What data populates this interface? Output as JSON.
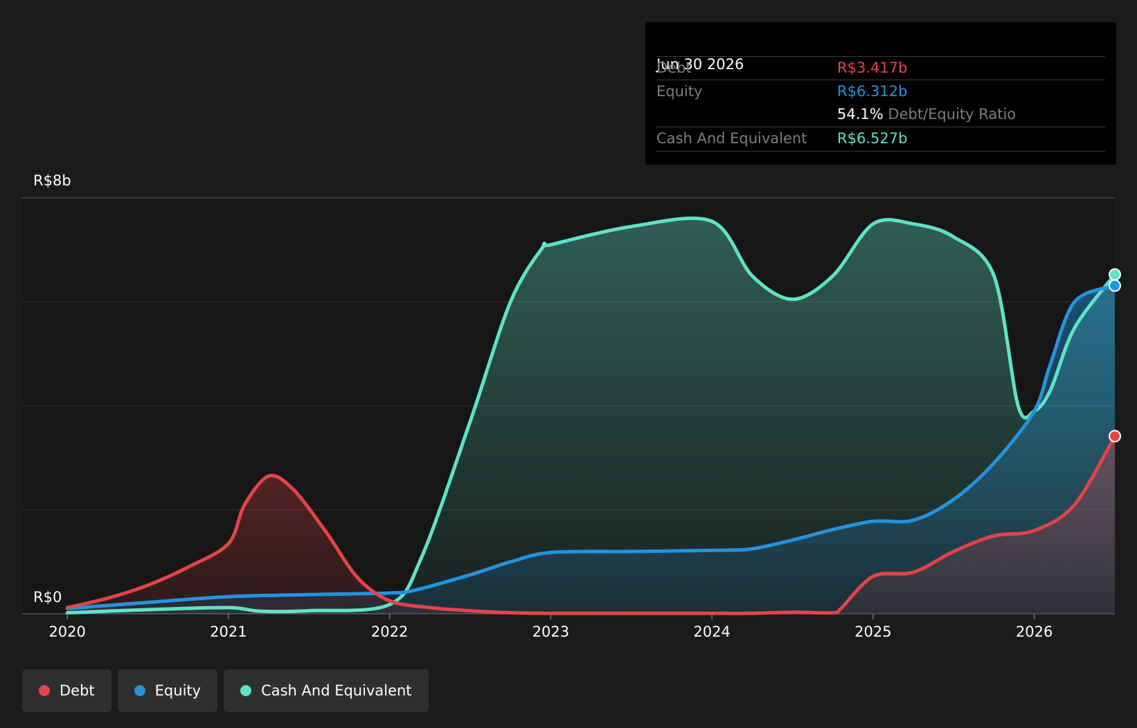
{
  "tooltip": {
    "date": "Jun 30 2026",
    "debt_label": "Debt",
    "debt_value": "R$3.417b",
    "equity_label": "Equity",
    "equity_value": "R$6.312b",
    "ratio_value": "54.1%",
    "ratio_label": "Debt/Equity Ratio",
    "cash_label": "Cash And Equivalent",
    "cash_value": "R$6.527b"
  },
  "colors": {
    "debt": "#e5434a",
    "equity": "#2394df",
    "cash": "#5ee2c6",
    "background": "#1b1b1b"
  },
  "legend": [
    {
      "label": "Debt",
      "color": "#e5434a"
    },
    {
      "label": "Equity",
      "color": "#2394df"
    },
    {
      "label": "Cash And Equivalent",
      "color": "#5ee2c6"
    }
  ],
  "chart_data": {
    "type": "area",
    "y_tick_labels": [
      "R$0",
      "R$8b"
    ],
    "ylim": [
      0,
      8
    ],
    "x_ticks": [
      "2020",
      "2021",
      "2022",
      "2023",
      "2024",
      "2025",
      "2026"
    ],
    "xlim": [
      2019.72,
      2026.5
    ],
    "grid": true,
    "legend_position": "bottom-left",
    "series": [
      {
        "name": "Debt",
        "x": [
          2020.0,
          2020.25,
          2020.5,
          2020.75,
          2021.0,
          2021.1,
          2021.25,
          2021.4,
          2021.6,
          2021.8,
          2022.0,
          2022.25,
          2022.5,
          2022.75,
          2023.0,
          2023.5,
          2024.0,
          2024.25,
          2024.5,
          2024.75,
          2024.8,
          2025.0,
          2025.25,
          2025.5,
          2025.75,
          2026.0,
          2026.25,
          2026.5
        ],
        "y": [
          0.12,
          0.3,
          0.55,
          0.9,
          1.35,
          2.1,
          2.65,
          2.4,
          1.6,
          0.7,
          0.25,
          0.12,
          0.06,
          0.02,
          0.01,
          0.01,
          0.01,
          0.01,
          0.03,
          0.02,
          0.1,
          0.72,
          0.8,
          1.2,
          1.5,
          1.6,
          2.1,
          3.417
        ]
      },
      {
        "name": "Equity",
        "x": [
          2020.0,
          2020.5,
          2021.0,
          2021.5,
          2022.0,
          2022.15,
          2022.5,
          2022.75,
          2023.0,
          2023.5,
          2024.0,
          2024.25,
          2024.5,
          2024.75,
          2025.0,
          2025.25,
          2025.5,
          2025.75,
          2026.0,
          2026.1,
          2026.25,
          2026.5
        ],
        "y": [
          0.1,
          0.22,
          0.33,
          0.37,
          0.4,
          0.45,
          0.75,
          1.0,
          1.18,
          1.2,
          1.22,
          1.25,
          1.42,
          1.62,
          1.78,
          1.8,
          2.2,
          2.9,
          3.9,
          4.8,
          6.0,
          6.312
        ]
      },
      {
        "name": "Cash And Equivalent",
        "x": [
          2020.0,
          2020.5,
          2021.0,
          2021.2,
          2021.5,
          2022.0,
          2022.2,
          2022.5,
          2022.75,
          2022.95,
          2023.0,
          2023.5,
          2024.0,
          2024.25,
          2024.5,
          2024.75,
          2025.0,
          2025.25,
          2025.5,
          2025.75,
          2025.9,
          2026.0,
          2026.1,
          2026.25,
          2026.5
        ],
        "y": [
          0.02,
          0.08,
          0.12,
          0.05,
          0.06,
          0.18,
          1.1,
          3.7,
          6.0,
          7.05,
          7.1,
          7.45,
          7.55,
          6.5,
          6.05,
          6.5,
          7.5,
          7.5,
          7.25,
          6.5,
          4.0,
          3.9,
          4.3,
          5.5,
          6.527
        ]
      }
    ]
  }
}
